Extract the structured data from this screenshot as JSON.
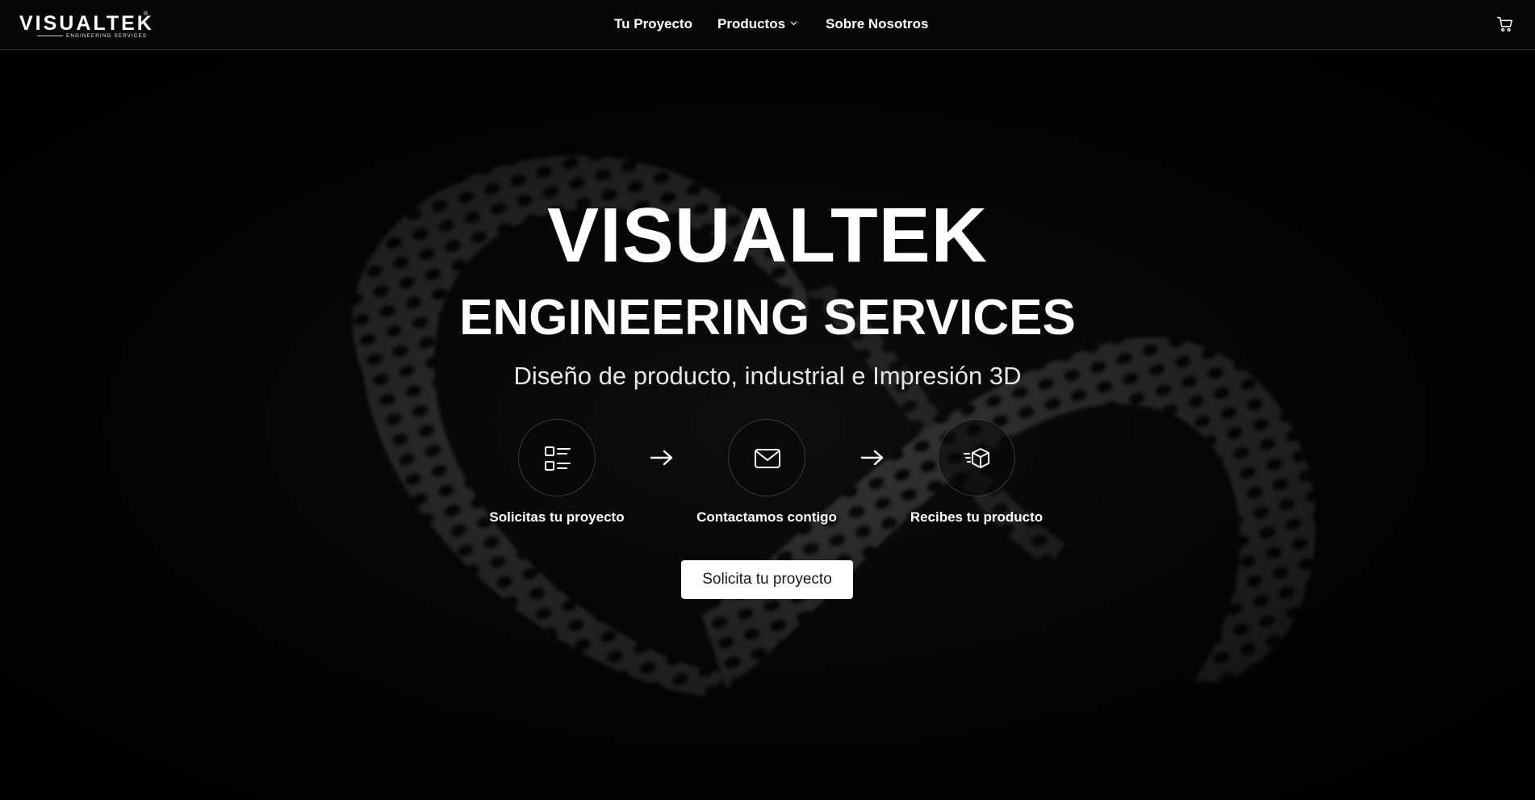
{
  "brand": {
    "logo_word": "VISUALTEK",
    "logo_registered": "®",
    "logo_sub": "ENGINEERING SERVICES"
  },
  "nav": {
    "items": [
      {
        "label": "Tu Proyecto"
      },
      {
        "label": "Productos",
        "has_dropdown": true
      },
      {
        "label": "Sobre Nosotros"
      }
    ],
    "cart_icon": "cart-icon"
  },
  "hero": {
    "title": "VISUALTEK",
    "subtitle": "ENGINEERING SERVICES",
    "tagline": "Diseño de producto, industrial e Impresión 3D",
    "steps": [
      {
        "icon": "list-icon",
        "label": "Solicitas tu proyecto"
      },
      {
        "icon": "mail-icon",
        "label": "Contactamos contigo"
      },
      {
        "icon": "box-delivery-icon",
        "label": "Recibes tu producto"
      }
    ],
    "arrow_icon": "arrow-right-icon",
    "cta_label": "Solicita tu proyecto"
  },
  "colors": {
    "background": "#0b0b0b",
    "header_background": "#070707",
    "text": "#ffffff",
    "cta_background": "#ffffff",
    "cta_text": "#1a1a1a"
  }
}
